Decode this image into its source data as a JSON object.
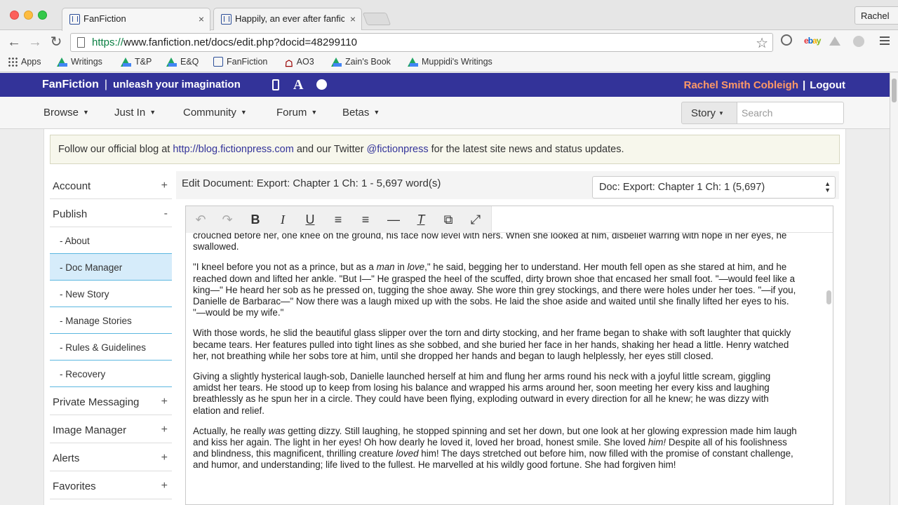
{
  "browser": {
    "tabs": [
      {
        "title": "FanFiction",
        "close": "×"
      },
      {
        "title": "Happily, an ever after fanfic",
        "close": "×"
      }
    ],
    "profile": "Rachel",
    "url_scheme": "https://",
    "url_rest": "www.fanfiction.net/docs/edit.php?docid=48299110",
    "nav": {
      "back": "←",
      "forward": "→",
      "reload": "↻",
      "star": "☆"
    },
    "ext_ebay": [
      "e",
      "b",
      "a",
      "y"
    ],
    "bookmarks": [
      "Apps",
      "Writings",
      "T&P",
      "E&Q",
      "FanFiction",
      "AO3",
      "Zain's Book",
      "Muppidi's Writings"
    ]
  },
  "site": {
    "brand": "FanFiction",
    "separator": "|",
    "tagline": "unleash your imagination",
    "font_glyph": "A",
    "user_name": "Rachel Smith Cobleigh",
    "user_sep": "|",
    "logout": "Logout",
    "nav": [
      "Browse",
      "Just In",
      "Community",
      "Forum",
      "Betas"
    ],
    "story_dropdown": "Story",
    "search_placeholder": "Search"
  },
  "notice": {
    "prefix": "Follow our official blog at ",
    "blog_link": "http://blog.fictionpress.com",
    "middle": " and our Twitter ",
    "twitter_link": "@fictionpress",
    "suffix": " for the latest site news and status updates."
  },
  "sidebar": {
    "account": "Account",
    "publish": "Publish",
    "publish_items": [
      "- About",
      "- Doc Manager",
      "- New Story",
      "- Manage Stories",
      "- Rules & Guidelines",
      "- Recovery"
    ],
    "private_messaging": "Private Messaging",
    "image_manager": "Image Manager",
    "alerts": "Alerts",
    "favorites": "Favorites",
    "plus": "+",
    "minus": "-"
  },
  "editor": {
    "doc_title": "Edit Document: Export: Chapter 1 Ch: 1 - 5,697 word(s)",
    "doc_select": "Doc: Export: Chapter 1 Ch: 1 (5,697)",
    "toolbar": {
      "undo": "↶",
      "redo": "↷",
      "bold": "B",
      "italic": "I",
      "underline": "U",
      "align_left": "≡",
      "align_center": "≡",
      "hr": "—",
      "clear": "T",
      "paste": "⧉",
      "fullscreen": "⤢"
    },
    "paragraphs": [
      {
        "before": "crouched before her, one knee on the ground, his face now level with hers. When she looked at him, disbelief warring with hope in her eyes, he swallowed."
      },
      {
        "before": "\"I kneel before you not as a prince, but as a ",
        "em1": "man",
        "mid1": " in ",
        "em2": "love",
        "after": ",\" he said, begging her to understand. Her mouth fell open as she stared at him, and he reached down and lifted her ankle. \"But I—\" He grasped the heel of the scuffed, dirty brown shoe that encased her small foot. \"—would feel like a king—\" He heard her sob as he pressed on, tugging the shoe away. She wore thin grey stockings, and there were holes under her toes. \"—if you, Danielle de Barbarac—\" Now there was a laugh mixed up with the sobs. He laid the shoe aside and waited until she finally lifted her eyes to his. \"—would be my wife.\""
      },
      {
        "before": "With those words, he slid the beautiful glass slipper over the torn and dirty stocking, and her frame began to shake with soft laughter that quickly became tears. Her features pulled into tight lines as she sobbed, and she buried her face in her hands, shaking her head a little. Henry watched her, not breathing while her sobs tore at him, until she dropped her hands and began to laugh helplessly, her eyes still closed."
      },
      {
        "before": "Giving a slightly hysterical laugh-sob, Danielle launched herself at him and flung her arms round his neck with a joyful little scream, giggling amidst her tears. He stood up to keep from losing his balance and wrapped his arms around her, soon meeting her every kiss and laughing breathlessly as he spun her in a circle. They could have been flying, exploding outward in every direction for all he knew; he was dizzy with elation and relief."
      },
      {
        "before": "Actually, he really ",
        "em1": "was",
        "mid1": " getting dizzy. Still laughing, he stopped spinning and set her down, but one look at her glowing expression made him laugh and kiss her again. The light in her eyes! Oh how dearly he loved it, loved her broad, honest smile. She loved ",
        "em2": "him!",
        "mid2": " Despite all of his foolishness and blindness, this magnificent, thrilling creature ",
        "em3": "loved",
        "after": " him! The days stretched out before him, now filled with the promise of constant challenge, and humor, and understanding; life lived to the fullest. He marvelled at his wildly good fortune. She had forgiven him!"
      }
    ]
  }
}
